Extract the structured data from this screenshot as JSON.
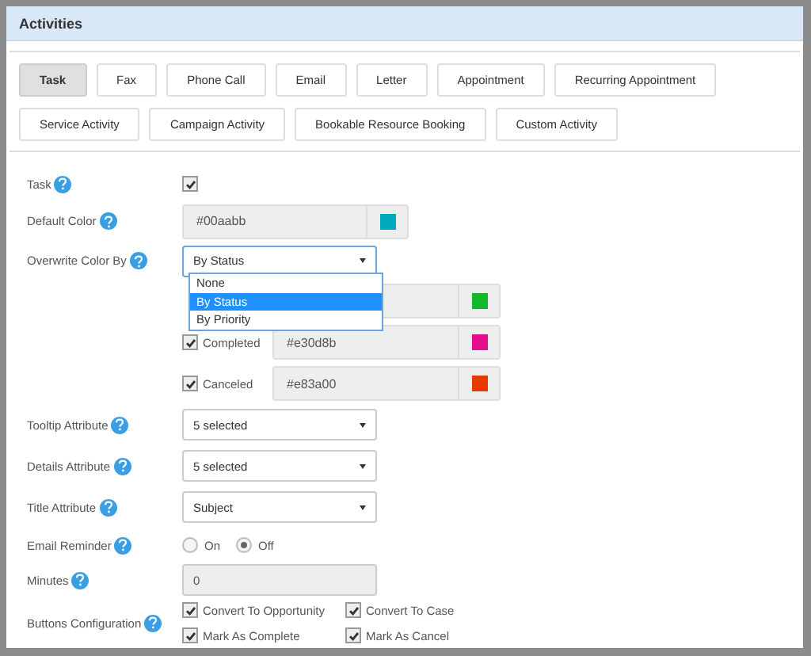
{
  "panel": {
    "title": "Activities"
  },
  "tabs": [
    {
      "label": "Task",
      "selected": true
    },
    {
      "label": "Fax",
      "selected": false
    },
    {
      "label": "Phone Call",
      "selected": false
    },
    {
      "label": "Email",
      "selected": false
    },
    {
      "label": "Letter",
      "selected": false
    },
    {
      "label": "Appointment",
      "selected": false
    },
    {
      "label": "Recurring Appointment",
      "selected": false
    },
    {
      "label": "Service Activity",
      "selected": false
    },
    {
      "label": "Campaign Activity",
      "selected": false
    },
    {
      "label": "Bookable Resource Booking",
      "selected": false
    },
    {
      "label": "Custom Activity",
      "selected": false
    }
  ],
  "task": {
    "label": "Task",
    "checked": true
  },
  "default_color": {
    "label": "Default Color",
    "value": "#00aabb",
    "color": "#00aabb"
  },
  "overwrite": {
    "label": "Overwrite Color By",
    "value": "By Status",
    "options": [
      {
        "label": "None",
        "selected": false
      },
      {
        "label": "By Status",
        "selected": true
      },
      {
        "label": "By Priority",
        "selected": false
      }
    ]
  },
  "status_colors": [
    {
      "color": "#10b82a"
    },
    {
      "label": "Completed",
      "checked": true,
      "value": "#e30d8b",
      "color": "#e30d8b"
    },
    {
      "label": "Canceled",
      "checked": true,
      "value": "#e83a00",
      "color": "#e83a00"
    }
  ],
  "selects": [
    {
      "label": "Tooltip Attribute",
      "value": "5 selected"
    },
    {
      "label": "Details Attribute",
      "value": "5 selected"
    },
    {
      "label": "Title Attribute",
      "value": "Subject"
    }
  ],
  "email_reminder": {
    "label": "Email Reminder",
    "options": [
      {
        "label": "On",
        "selected": false
      },
      {
        "label": "Off",
        "selected": true
      }
    ]
  },
  "minutes": {
    "label": "Minutes",
    "value": "0"
  },
  "buttons_configuration": {
    "label": "Buttons Configuration",
    "options": [
      {
        "label": "Convert To Opportunity",
        "checked": true
      },
      {
        "label": "Convert To Case",
        "checked": true
      },
      {
        "label": "Mark As Complete",
        "checked": true
      },
      {
        "label": "Mark As Cancel",
        "checked": true
      }
    ]
  }
}
